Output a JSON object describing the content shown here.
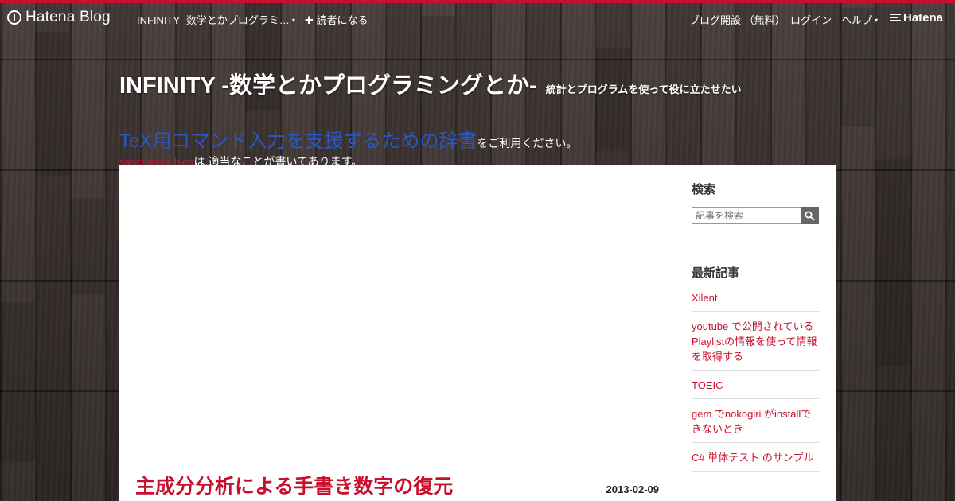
{
  "globalheader": {
    "logo_text": "Hatena Blog",
    "blog_menu": "INFINITY -数学とかプログラミ…",
    "subscribe": "✚ 読者になる",
    "open_blog": "ブログ開設 （無料）",
    "login": "ログイン",
    "help": "ヘルプ",
    "hatena": "Hatena",
    "caret": "▾"
  },
  "blog": {
    "title": "INFINITY -数学とかプログラミングとか-",
    "description": "統計とプログラムを使って役に立たせたい"
  },
  "announce": {
    "tex_link": "TeX用コマンド入力を支援するための辞書",
    "tex_suffix": "をご利用ください。",
    "author_link": "sanctuary's blog",
    "author_suffix": "は,適当なことが書いてあります。"
  },
  "entry": {
    "title": "主成分分析による手書き数字の復元",
    "date": "2013-02-09"
  },
  "sidebar": {
    "search_title": "検索",
    "search_placeholder": "記事を検索",
    "recent_title": "最新記事",
    "recent": [
      "Xilent",
      "youtube で公開されているPlaylistの情報を使って情報を取得する",
      "TOEIC",
      "gem でnokogiri がinstallできないとき",
      "C# 単体テスト のサンプル"
    ]
  },
  "colors": {
    "accent": "#c8102e",
    "link_blue": "#2a57c6",
    "wood": "#3a3230"
  }
}
